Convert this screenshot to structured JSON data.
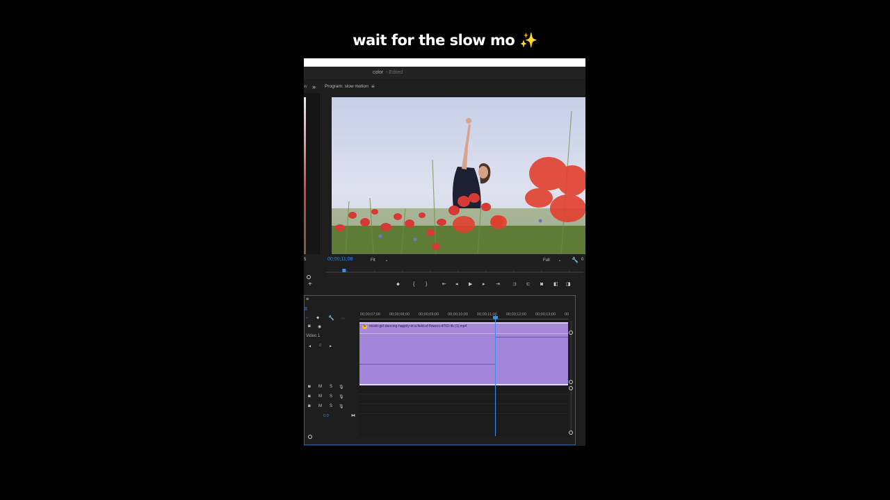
{
  "caption": {
    "text": "wait for the slow mo",
    "emoji": "✨"
  },
  "window": {
    "project_name": "color",
    "project_state": "- Edited"
  },
  "panels": {
    "left_tab_fragment": "w",
    "overflow_icon": "»",
    "program_title": "Program: slow motion",
    "menu_icon": "≡"
  },
  "monitor": {
    "timecode": "00;00;11;08",
    "fit_label": "Fit",
    "resolution_label": "Full",
    "left_fragment": "5",
    "right_fragment": "0",
    "playhead_position": 0.07
  },
  "timeline": {
    "menu_icon": "≡",
    "ruler_labels": [
      "00;00;07;00",
      "00;00;08;00",
      "00;00;09;00",
      "00;00;10;00",
      "00;00;11;00",
      "00;00;12;00",
      "00;00;13;00",
      "00"
    ],
    "track_video_label": "Video 1",
    "video_keyframe_value": "0",
    "clip_name": "mixkit-girl-dancing-happily-in-a-field-of-flowers-4702-4k (1).mp4",
    "fx_badge": "fx",
    "audio_tracks": [
      {
        "m": "M",
        "s": "S"
      },
      {
        "m": "M",
        "s": "S"
      },
      {
        "m": "M",
        "s": "S"
      }
    ],
    "master_value": "0.0",
    "left_fragment": "8"
  },
  "colors": {
    "accent": "#2d8ceb",
    "clip": "#a186d9",
    "panel_bg": "#1e1e1e"
  }
}
